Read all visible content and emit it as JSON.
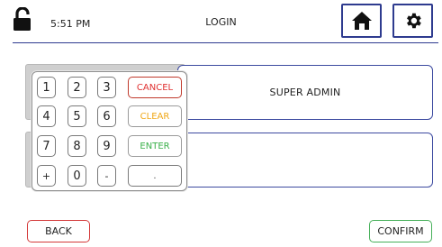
{
  "header": {
    "time": "5:51 PM",
    "title": "LOGIN",
    "lock_icon": "unlocked-padlock",
    "home_icon": "home",
    "settings_icon": "gear"
  },
  "fields": {
    "username_value": "SUPER ADMIN",
    "password_value": ""
  },
  "keypad": {
    "keys": [
      "1",
      "2",
      "3",
      "4",
      "5",
      "6",
      "7",
      "8",
      "9",
      "+",
      "0",
      "-"
    ],
    "cancel": "CANCEL",
    "clear": "CLEAR",
    "enter": "ENTER",
    "dot": "."
  },
  "footer": {
    "back": "BACK",
    "confirm": "CONFIRM"
  },
  "colors": {
    "accent": "#2e3b8f",
    "cancel": "#e03030",
    "clear": "#f0a818",
    "enter": "#3ab04a"
  }
}
